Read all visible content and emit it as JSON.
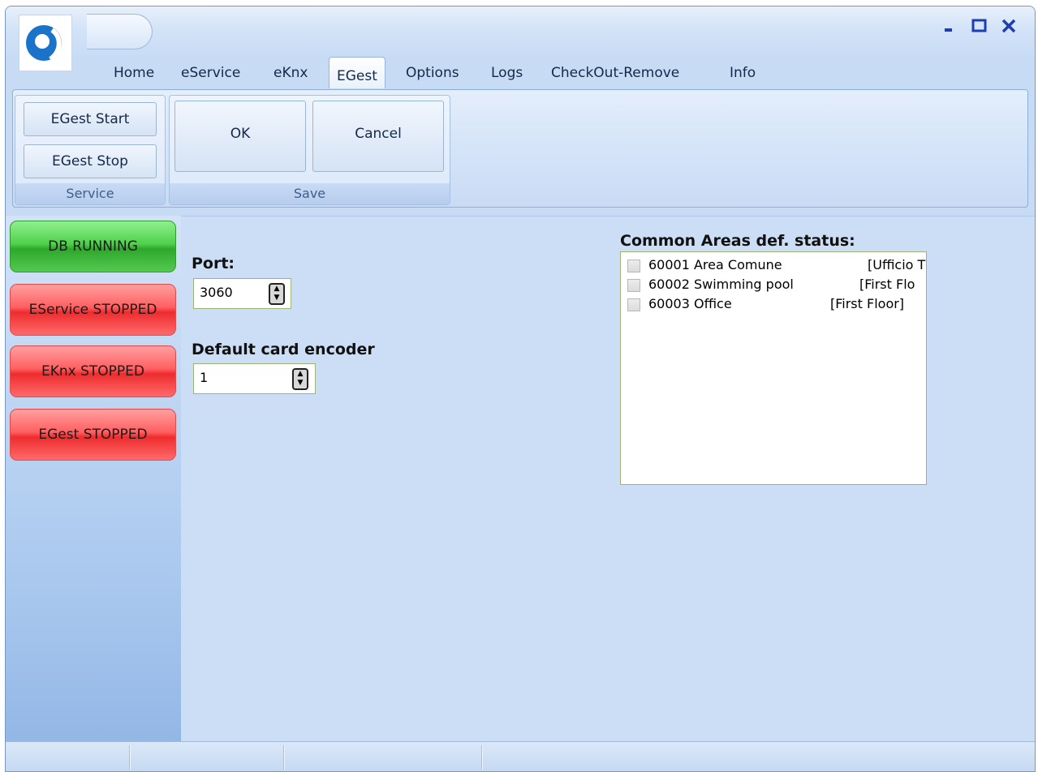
{
  "window": {
    "controls": [
      "minimize-icon",
      "maximize-icon",
      "close-icon"
    ]
  },
  "tabs": [
    {
      "label": "Home",
      "active": false
    },
    {
      "label": "eService",
      "active": false
    },
    {
      "label": "eKnx",
      "active": false
    },
    {
      "label": "EGest",
      "active": true
    },
    {
      "label": "Options",
      "active": false
    },
    {
      "label": "Logs",
      "active": false
    },
    {
      "label": "CheckOut-Remove",
      "active": false
    },
    {
      "label": "Info",
      "active": false
    }
  ],
  "ribbon": {
    "service": {
      "label": "Service",
      "start": "EGest Start",
      "stop": "EGest Stop"
    },
    "save": {
      "label": "Save",
      "ok": "OK",
      "cancel": "Cancel"
    }
  },
  "status_buttons": [
    {
      "label": "DB RUNNING",
      "color": "#4fd04c"
    },
    {
      "label": "EService STOPPED",
      "color": "#ff4f51"
    },
    {
      "label": "EKnx STOPPED",
      "color": "#ff4f51"
    },
    {
      "label": "EGest STOPPED",
      "color": "#ff4f51"
    }
  ],
  "form": {
    "port": {
      "label": "Port:",
      "value": "3060"
    },
    "encoder": {
      "label": "Default card encoder",
      "value": "1"
    }
  },
  "common_areas": {
    "title": "Common Areas def. status:",
    "items": [
      {
        "name": "60001 Area Comune",
        "location": "[Ufficio T",
        "checked": false
      },
      {
        "name": "60002 Swimming pool",
        "location": "[First Flo",
        "checked": false
      },
      {
        "name": "60003 Office",
        "location": "[First Floor]",
        "checked": false
      }
    ]
  },
  "colors": {
    "window_background": "#c7dbf4",
    "running": "#4fd04c",
    "stopped": "#ff4f51",
    "window_controls": "#1b3fb0"
  }
}
